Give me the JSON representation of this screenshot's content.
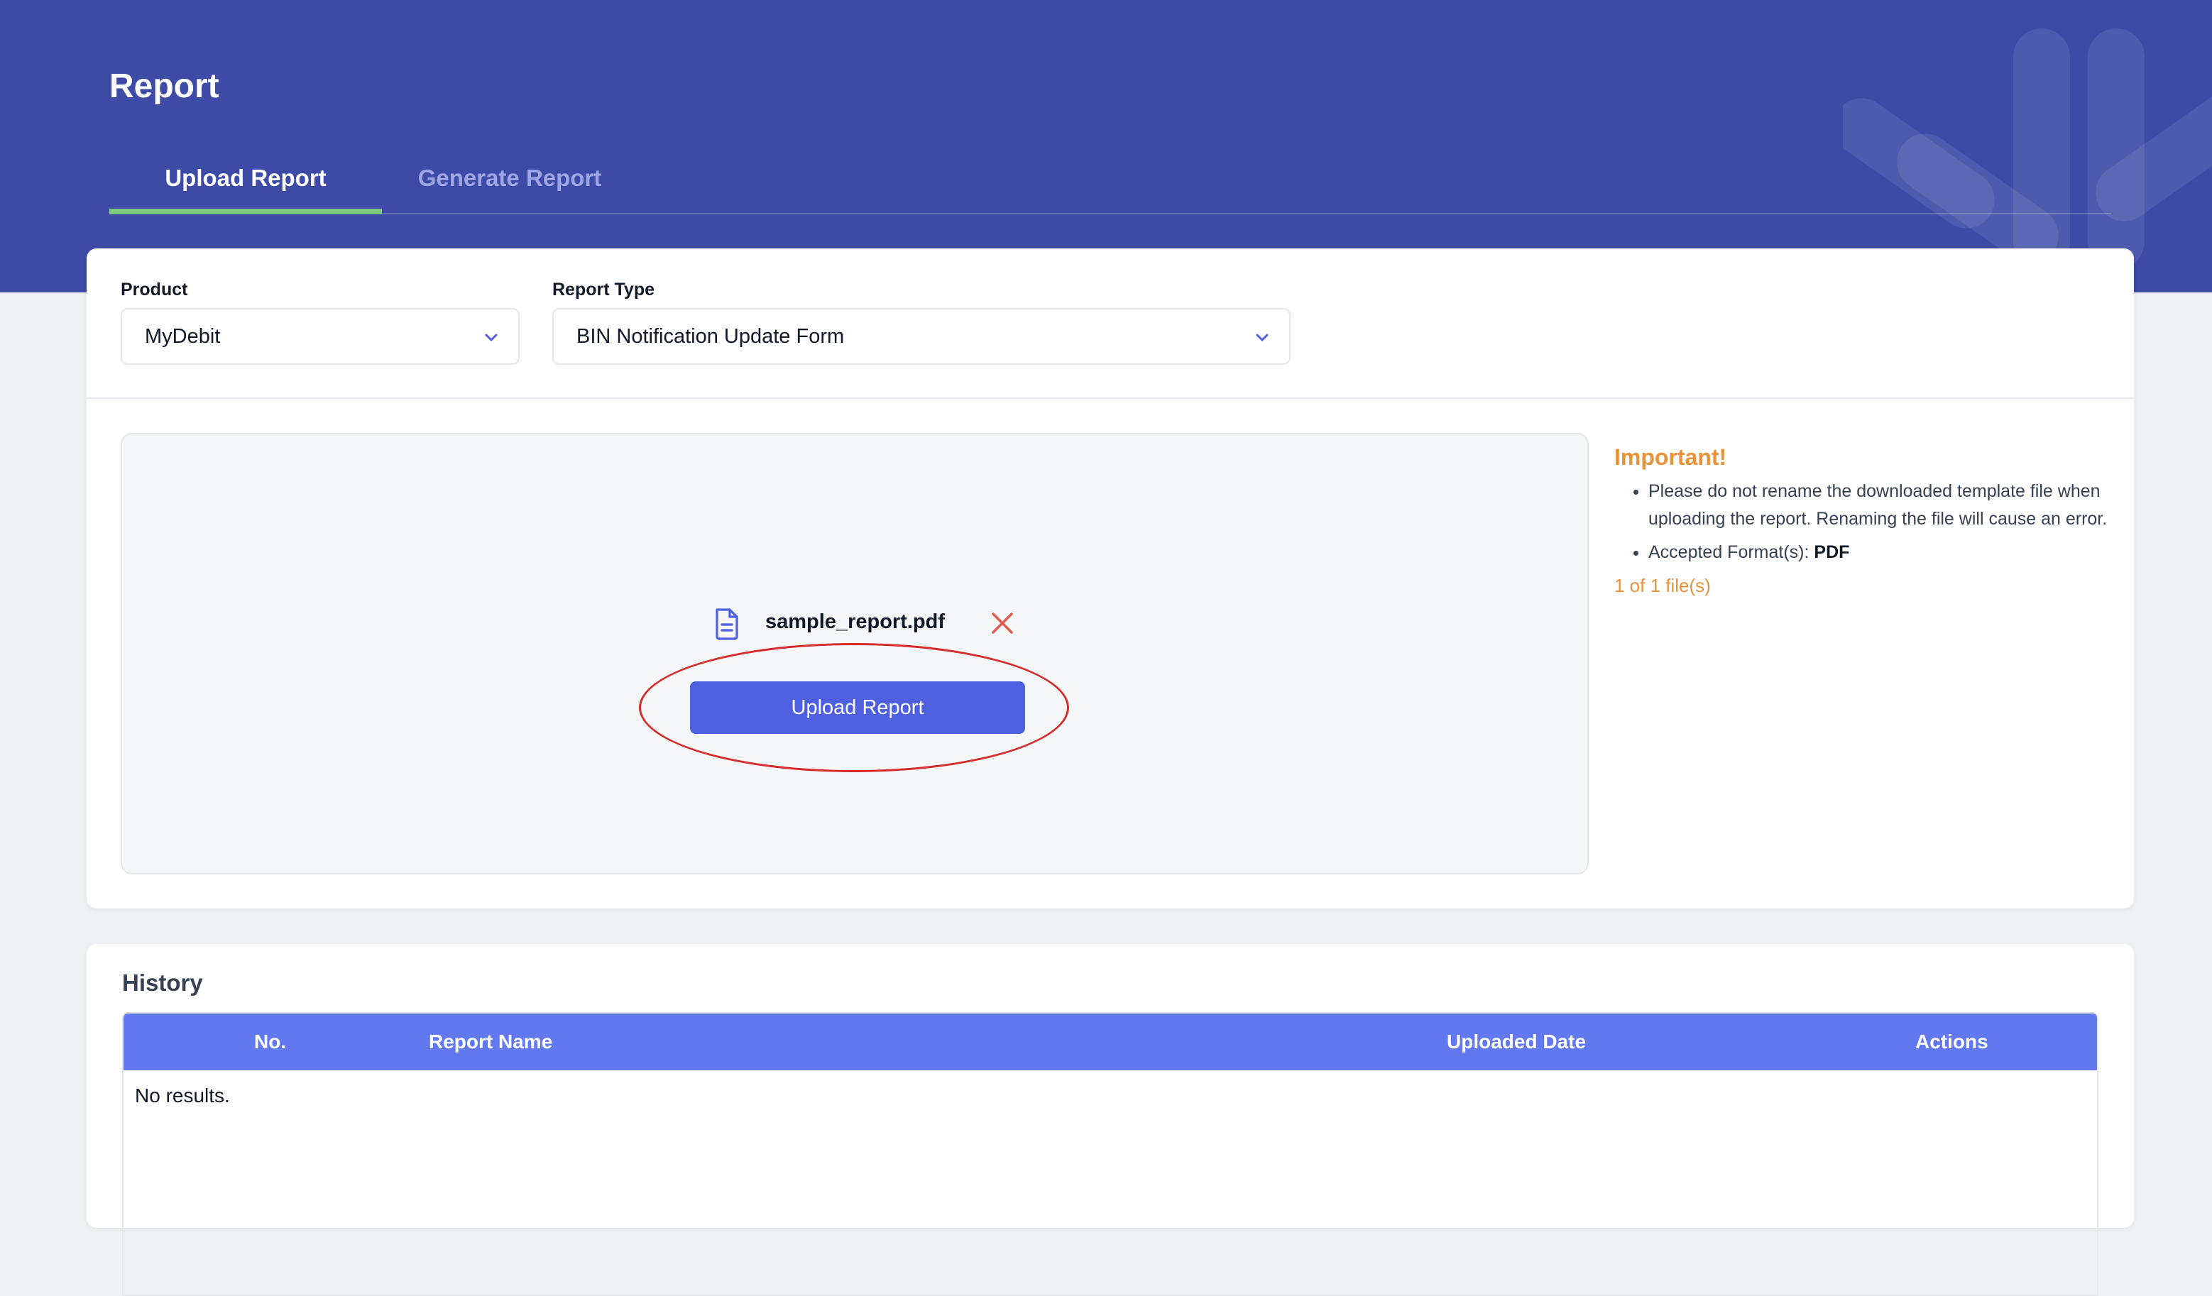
{
  "page": {
    "title": "Report"
  },
  "tabs": [
    {
      "label": "Upload Report",
      "active": true
    },
    {
      "label": "Generate Report",
      "active": false
    }
  ],
  "filters": {
    "product": {
      "label": "Product",
      "value": "MyDebit"
    },
    "report_type": {
      "label": "Report Type",
      "value": "BIN Notification Update Form"
    }
  },
  "upload": {
    "file_name": "sample_report.pdf",
    "button_label": "Upload Report"
  },
  "info": {
    "title": "Important!",
    "notes": [
      "Please do not rename the downloaded template file when uploading the report. Renaming the file will cause an error."
    ],
    "format_label": "Accepted Format(s):",
    "format_value": "PDF",
    "file_count": "1 of 1 file(s)"
  },
  "history": {
    "title": "History",
    "columns": [
      "No.",
      "Report Name",
      "Uploaded Date",
      "Actions"
    ],
    "empty_text": "No results."
  },
  "colors": {
    "header_bg": "#3d4aa6",
    "active_tab_underline": "#7cc97a",
    "primary_button": "#4e5fe0",
    "table_header": "#6278ee",
    "important": "#e8923a",
    "remove": "#e05a4f",
    "highlight": "#d62b2b"
  }
}
